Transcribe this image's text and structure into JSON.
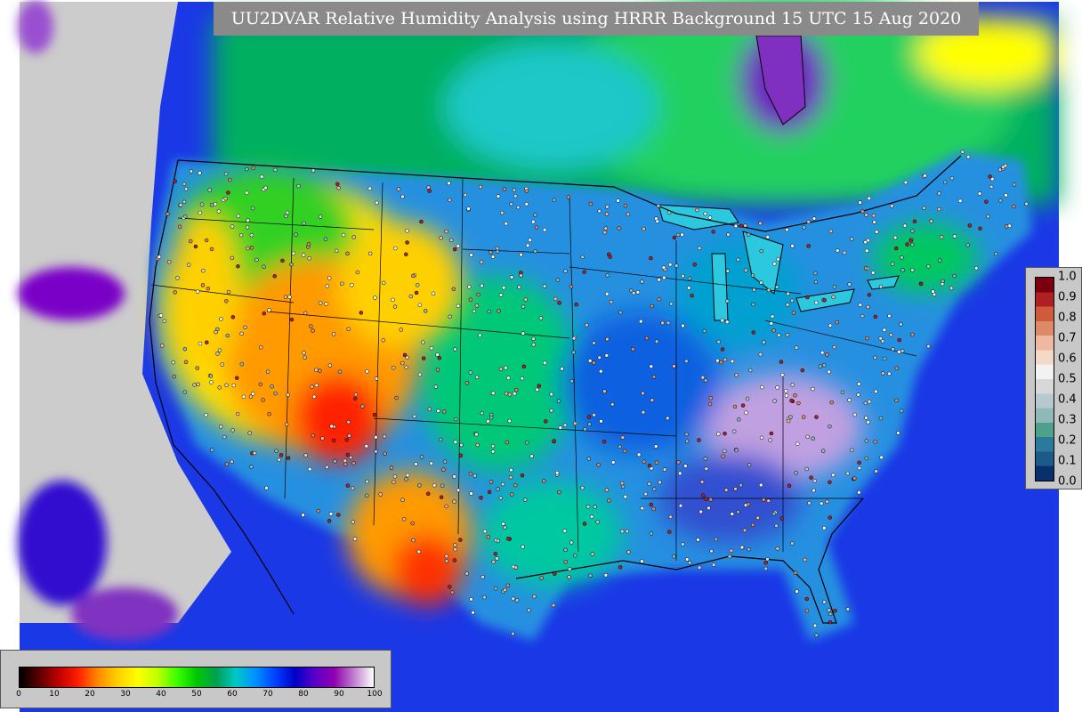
{
  "title": "UU2DVAR Relative Humidity Analysis using HRRR Background 15 UTC 15 Aug 2020",
  "humidity_colorbar": {
    "ticks": [
      "0",
      "10",
      "20",
      "30",
      "40",
      "50",
      "60",
      "70",
      "80",
      "90",
      "100"
    ],
    "stops": [
      "#000000",
      "#5a0000",
      "#c00000",
      "#ff2000",
      "#ff8c00",
      "#ffd000",
      "#ffff00",
      "#c0ff00",
      "#3cff00",
      "#00c800",
      "#00a050",
      "#00c8c8",
      "#0090ff",
      "#0040ff",
      "#0000c8",
      "#5a00c8",
      "#9000b0",
      "#c080d0",
      "#ffffff"
    ]
  },
  "value_colorbar": {
    "ticks": [
      "1.0",
      "0.9",
      "0.8",
      "0.7",
      "0.6",
      "0.5",
      "0.4",
      "0.3",
      "0.2",
      "0.1",
      "0.0"
    ],
    "colors": [
      "#08306b",
      "#1c5a8a",
      "#2a7a9c",
      "#4fa08a",
      "#8fb8b8",
      "#b8c8d0",
      "#d8d8d8",
      "#f2f2f2",
      "#f4d8c8",
      "#f0b8a0",
      "#dc8a68",
      "#d05a3c",
      "#b02020",
      "#7a0010"
    ]
  },
  "map_colors": {
    "ocean": "#1030e0",
    "ocean_west": "#cccccc",
    "north": "#00c840",
    "land_moist": "#00a0d8",
    "land_dry": "#ffb000"
  }
}
